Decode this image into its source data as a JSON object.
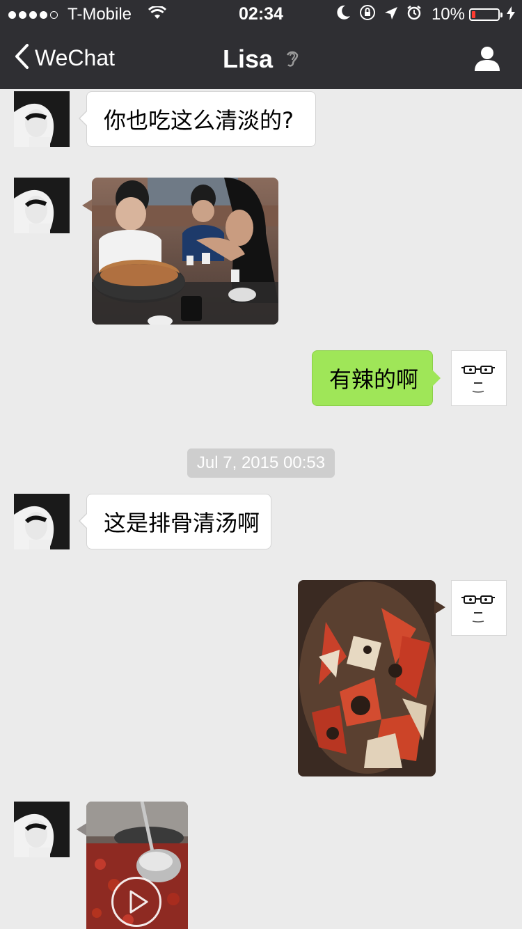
{
  "status_bar": {
    "carrier": "T-Mobile",
    "signal_bars_filled": 4,
    "signal_bars_total": 5,
    "time": "02:34",
    "battery_percent": "10%",
    "icons": [
      "wifi-icon",
      "moon-icon",
      "orientation-lock-icon",
      "location-arrow-icon",
      "alarm-icon",
      "battery-icon",
      "charging-bolt-icon"
    ]
  },
  "nav": {
    "back_label": "WeChat",
    "title": "Lisa",
    "title_icon": "earpiece-mode-icon",
    "right_icon": "contact-profile-icon"
  },
  "messages": [
    {
      "sender": "Lisa",
      "type": "text",
      "text": "你也吃这么清淡的?"
    },
    {
      "sender": "Lisa",
      "type": "image",
      "content": "hotpot-group-photo"
    },
    {
      "sender": "me",
      "type": "text",
      "text": "有辣的啊"
    },
    {
      "sender": "Lisa",
      "type": "text",
      "text": "这是排骨清汤啊"
    },
    {
      "sender": "me",
      "type": "image",
      "content": "crab-dish-photo"
    },
    {
      "sender": "Lisa",
      "type": "video",
      "content": "crayfish-pot-video"
    }
  ],
  "timestamp": "Jul 7, 2015 00:53",
  "colors": {
    "nav_bg": "#2f2f33",
    "chat_bg": "#ebebeb",
    "outgoing_bubble": "#9fe658",
    "incoming_bubble": "#ffffff",
    "battery_low": "#ff3b30",
    "timestamp_pill": "#cecece"
  }
}
